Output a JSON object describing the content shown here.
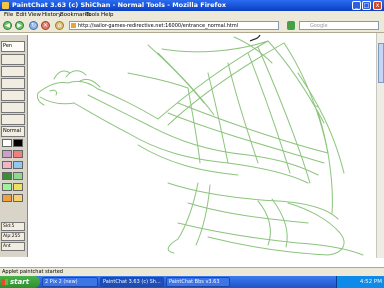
{
  "window": {
    "title": "PaintChat 3.63 (c) ShiChan - Normal Tools - Mozilla Firefox"
  },
  "window_controls": {
    "minimize": "_",
    "maximize": "□",
    "close": "x"
  },
  "menu": [
    "File",
    "Edit",
    "View",
    "History",
    "Bookmarks",
    "Tools",
    "Help"
  ],
  "nav": {
    "back": "◀",
    "forward": "▶",
    "reload": "↻",
    "stop": "✕",
    "home": "⌂"
  },
  "address": {
    "url": "http://sailor-games-redirective.net:16000/entrance_normal.html"
  },
  "search": {
    "placeholder": "Google"
  },
  "tools": {
    "pen_label": "Pen",
    "normal_label": "Normal",
    "swatches": [
      "#ffffff",
      "#000000",
      "#c8a0c8",
      "#f08080",
      "#f4b4c8",
      "#90c8f0",
      "#3c8c3c",
      "#90d890",
      "#a0f0a0",
      "#f0e060",
      "#f0a040",
      "#f8d070"
    ],
    "bottom_labels": [
      "Sld:5",
      "Alp:255",
      "Ant"
    ]
  },
  "drawing": {
    "stroke_color": "#8cc47c"
  },
  "status": {
    "text": "Applet paintchat started"
  },
  "taskbar": {
    "start_label": "start",
    "tasks": [
      "2 Pix 2 (new)",
      "PaintChat 3.63 (c) Sh...",
      "PaintChat Bbs v3.63"
    ],
    "clock": "4:52 PM"
  }
}
